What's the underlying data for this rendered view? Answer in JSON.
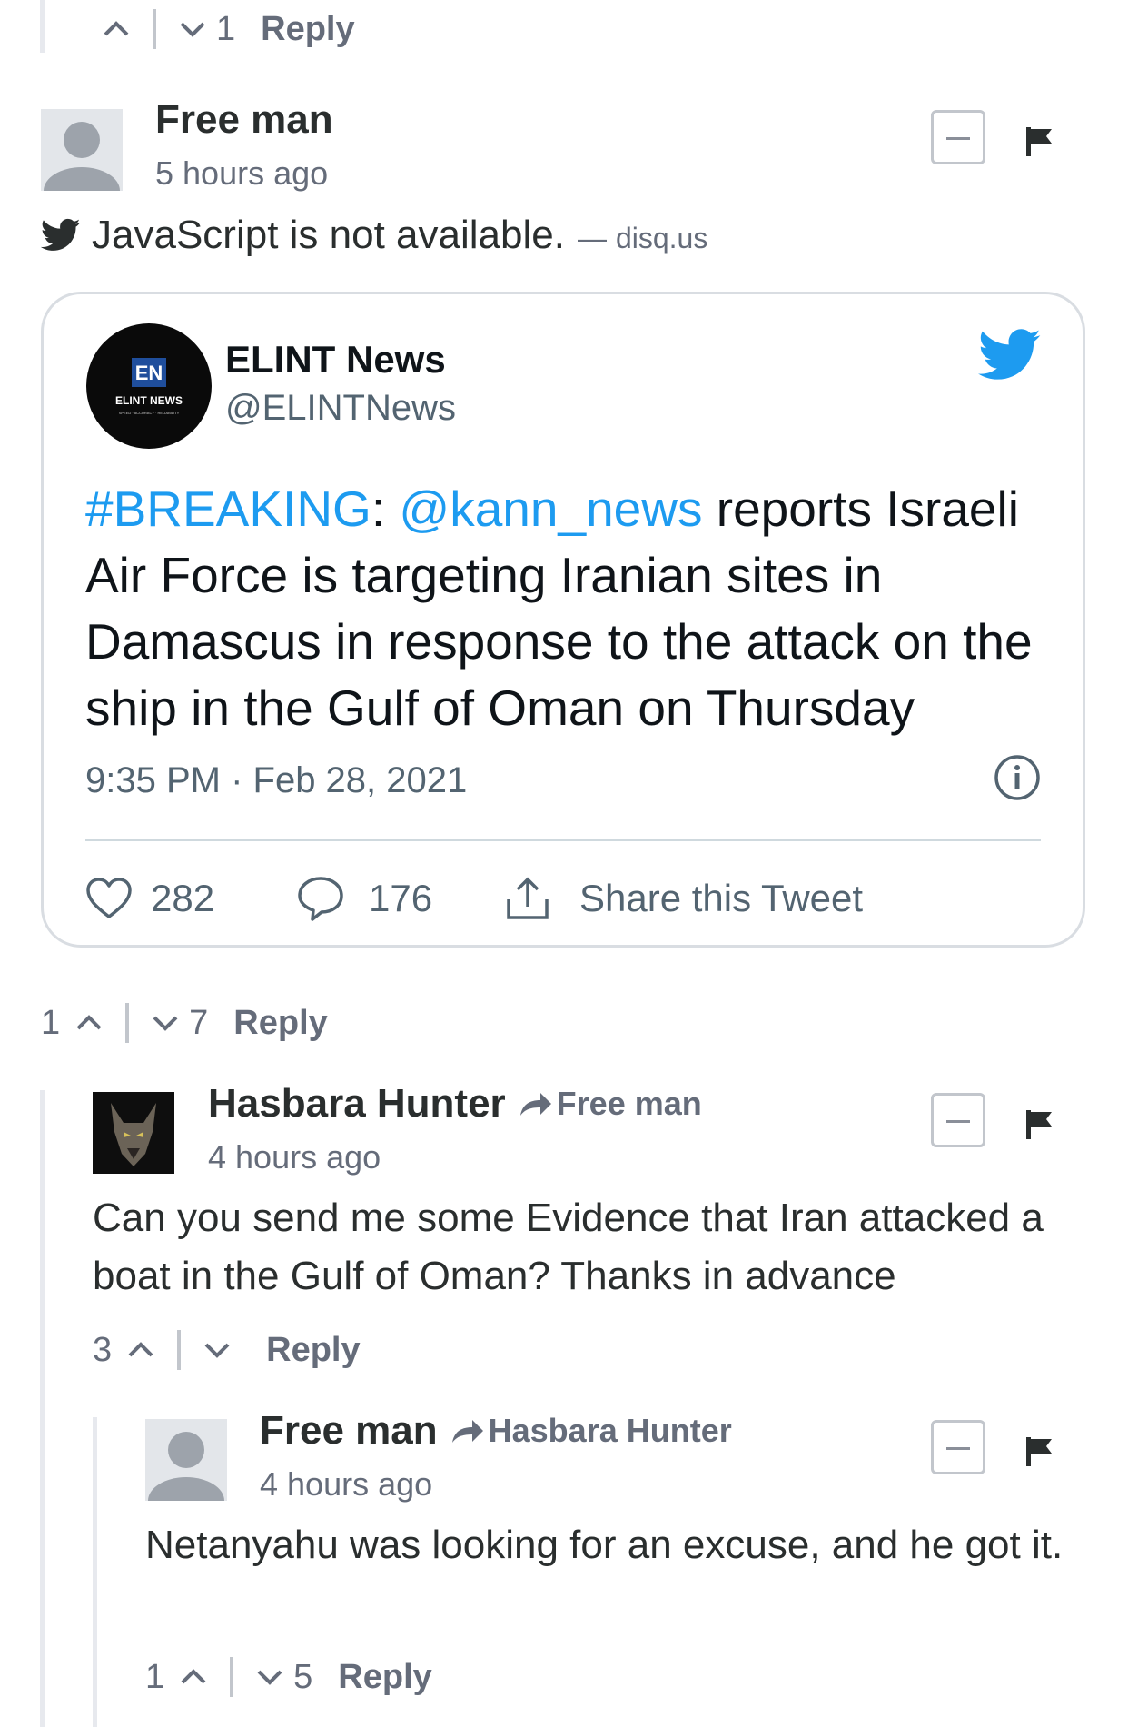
{
  "top_bar": {
    "down_count": "1",
    "reply_label": "Reply"
  },
  "comment1": {
    "author": "Free man",
    "time": "5 hours ago",
    "embed_text": "JavaScript is not available.",
    "embed_sep": "—",
    "embed_source": "disq.us"
  },
  "tweet": {
    "name": "ELINT News",
    "handle": "@ELINTNews",
    "avatar_logo": "EN",
    "avatar_caption": "ELINT NEWS",
    "avatar_tagline": "SPEED · ACCURACY · RELIABILITY",
    "hashtag": "#BREAKING",
    "colon": ":",
    "mention": "@kann_news",
    "text": " reports Israeli Air Force is targeting Iranian sites in Damascus in response to the attack on the ship in the Gulf of Oman on Thursday",
    "timestamp": "9:35 PM · Feb 28, 2021",
    "likes": "282",
    "replies": "176",
    "share_label": "Share this Tweet",
    "link_color": "#1d9bf0"
  },
  "comment1_votes": {
    "up_count": "1",
    "down_count": "7",
    "reply_label": "Reply"
  },
  "comment2": {
    "author": "Hasbara Hunter",
    "reply_to": "Free man",
    "time": "4 hours ago",
    "text": "Can you send me some Evidence that Iran attacked a boat in the Gulf of Oman? Thanks in advance",
    "up_count": "3",
    "reply_label": "Reply"
  },
  "comment3": {
    "author": "Free man",
    "reply_to": "Hasbara Hunter",
    "time": "4 hours ago",
    "text": "Netanyahu was looking for an excuse, and he got it.",
    "up_count": "1",
    "down_count": "5",
    "reply_label": "Reply"
  },
  "icons": {
    "upvote": "chevron-up-icon",
    "downvote": "chevron-down-icon",
    "collapse": "minus-box-icon",
    "flag": "flag-icon",
    "twitter": "twitter-bird-icon",
    "info": "info-icon",
    "like": "heart-icon",
    "reply": "speech-bubble-icon",
    "share": "share-icon",
    "reply_to": "arrow-right-icon"
  }
}
